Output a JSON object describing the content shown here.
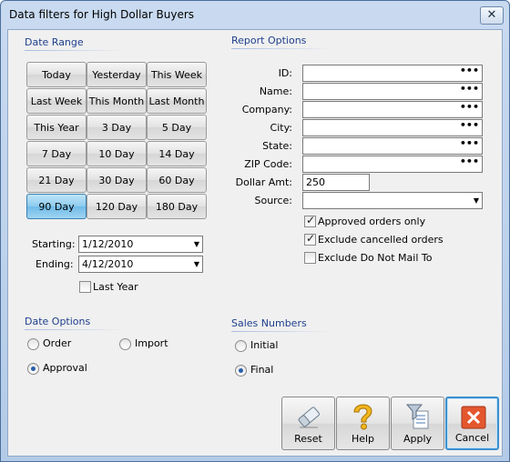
{
  "window": {
    "title": "Data filters for High Dollar Buyers",
    "close_label": "✕"
  },
  "date_range": {
    "heading": "Date Range",
    "buttons": [
      "Today",
      "Yesterday",
      "This Week",
      "Last Week",
      "This Month",
      "Last Month",
      "This Year",
      "3 Day",
      "5 Day",
      "7 Day",
      "10 Day",
      "14 Day",
      "21 Day",
      "30 Day",
      "60 Day",
      "90 Day",
      "120 Day",
      "180 Day"
    ],
    "selected": "90 Day",
    "starting_label": "Starting:",
    "starting_value": "1/12/2010",
    "ending_label": "Ending:",
    "ending_value": "4/12/2010",
    "last_year_label": "Last Year",
    "last_year_checked": false
  },
  "report_options": {
    "heading": "Report Options",
    "id_label": "ID:",
    "name_label": "Name:",
    "company_label": "Company:",
    "city_label": "City:",
    "state_label": "State:",
    "zip_label": "ZIP Code:",
    "dollar_label": "Dollar Amt:",
    "dollar_value": "250",
    "source_label": "Source:",
    "lookup_glyph": "•••",
    "approved_label": "Approved orders only",
    "approved_checked": true,
    "exclude_cancelled_label": "Exclude cancelled orders",
    "exclude_cancelled_checked": true,
    "exclude_dnm_label": "Exclude Do Not Mail To",
    "exclude_dnm_checked": false
  },
  "date_options": {
    "heading": "Date Options",
    "order_label": "Order",
    "import_label": "Import",
    "approval_label": "Approval",
    "selected": "Approval"
  },
  "sales_numbers": {
    "heading": "Sales Numbers",
    "initial_label": "Initial",
    "final_label": "Final",
    "selected": "Final"
  },
  "actions": {
    "reset": "Reset",
    "help": "Help",
    "apply": "Apply",
    "cancel": "Cancel"
  }
}
